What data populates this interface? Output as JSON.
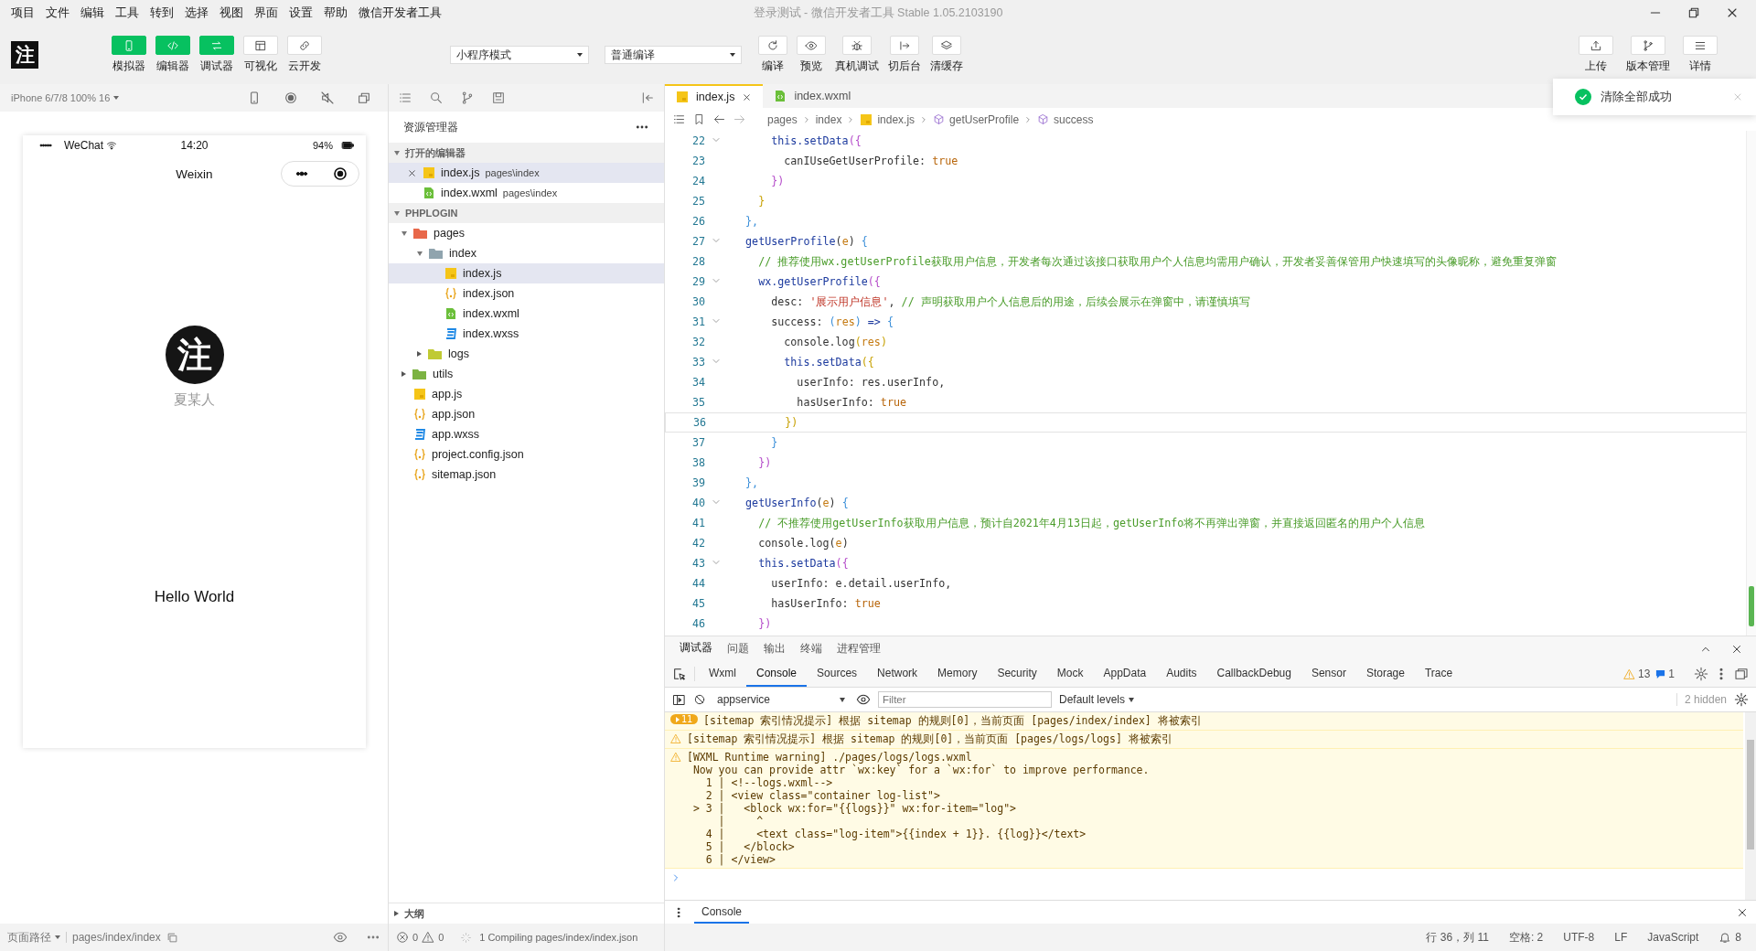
{
  "menu_bar": {
    "items": [
      "项目",
      "文件",
      "编辑",
      "工具",
      "转到",
      "选择",
      "视图",
      "界面",
      "设置",
      "帮助",
      "微信开发者工具"
    ],
    "title": "登录测试 - 微信开发者工具 Stable 1.05.2103190"
  },
  "toolbar": {
    "logo_text": "注",
    "view_buttons": [
      {
        "label": "模拟器",
        "active": true
      },
      {
        "label": "编辑器",
        "active": true
      },
      {
        "label": "调试器",
        "active": true
      },
      {
        "label": "可视化",
        "active": false
      },
      {
        "label": "云开发",
        "active": false
      }
    ],
    "mode_select": "小程序模式",
    "compile_select": "普通编译",
    "action_buttons": [
      "编译",
      "预览",
      "真机调试",
      "切后台",
      "清缓存"
    ],
    "right_buttons": [
      "上传",
      "版本管理",
      "详情"
    ]
  },
  "toast": {
    "text": "清除全部成功"
  },
  "simulator": {
    "device": "iPhone 6/7/8 100% 16",
    "carrier": "WeChat",
    "time": "14:20",
    "battery": "94%",
    "nav_title": "Weixin",
    "avatar_text": "注",
    "user_name": "夏某人",
    "greeting": "Hello World",
    "page_path_label": "页面路径",
    "page_path": "pages/index/index"
  },
  "explorer": {
    "title": "资源管理器",
    "open_editors_title": "打开的编辑器",
    "open_editors": [
      {
        "name": "index.js",
        "path": "pages\\index",
        "kind": "js",
        "selected": true
      },
      {
        "name": "index.wxml",
        "path": "pages\\index",
        "kind": "wxml",
        "selected": false
      }
    ],
    "project_title": "PHPLOGIN",
    "tree": [
      {
        "name": "pages",
        "kind": "folder",
        "color": "#e8684a",
        "expanded": true,
        "selected": false,
        "children": [
          {
            "name": "index",
            "kind": "folder",
            "color": "#90a4ae",
            "expanded": true,
            "selected": false,
            "children": [
              {
                "name": "index.js",
                "kind": "js",
                "selected": true
              },
              {
                "name": "index.json",
                "kind": "json",
                "selected": false
              },
              {
                "name": "index.wxml",
                "kind": "wxml",
                "selected": false
              },
              {
                "name": "index.wxss",
                "kind": "wxss",
                "selected": false
              }
            ]
          },
          {
            "name": "logs",
            "kind": "folder",
            "color": "#c0ca33",
            "expanded": false,
            "selected": false
          }
        ]
      },
      {
        "name": "utils",
        "kind": "folder",
        "color": "#7cb342",
        "expanded": false,
        "selected": false
      },
      {
        "name": "app.js",
        "kind": "js",
        "selected": false
      },
      {
        "name": "app.json",
        "kind": "json",
        "selected": false
      },
      {
        "name": "app.wxss",
        "kind": "wxss",
        "selected": false
      },
      {
        "name": "project.config.json",
        "kind": "json",
        "selected": false
      },
      {
        "name": "sitemap.json",
        "kind": "json",
        "selected": false
      }
    ],
    "outline_title": "大纲",
    "errors": "0",
    "warnings": "0",
    "compile_status": "1 Compiling pages/index/index.json"
  },
  "editor": {
    "tabs": [
      {
        "label": "index.js",
        "kind": "js",
        "selected": true
      },
      {
        "label": "index.wxml",
        "kind": "wxml",
        "selected": false
      }
    ],
    "breadcrumb": [
      {
        "text": "pages",
        "kind": "folder"
      },
      {
        "text": "index",
        "kind": "folder"
      },
      {
        "text": "index.js",
        "kind": "js"
      },
      {
        "text": "getUserProfile",
        "kind": "method"
      },
      {
        "text": "success",
        "kind": "method"
      }
    ],
    "lines": [
      {
        "number": "22",
        "foldable": true,
        "current": false,
        "tokens": [
          {
            "text": "      this.setData",
            "kind": "keyword"
          },
          {
            "text": "({",
            "kind": "b2"
          }
        ]
      },
      {
        "number": "23",
        "foldable": false,
        "current": false,
        "tokens": [
          {
            "text": "        canIUseGetUserProfile: ",
            "kind": "plain"
          },
          {
            "text": "true",
            "kind": "bool"
          }
        ]
      },
      {
        "number": "24",
        "foldable": false,
        "current": false,
        "tokens": [
          {
            "text": "      })",
            "kind": "b2"
          }
        ]
      },
      {
        "number": "25",
        "foldable": false,
        "current": false,
        "tokens": [
          {
            "text": "    }",
            "kind": "b1"
          }
        ]
      },
      {
        "number": "26",
        "foldable": false,
        "current": false,
        "tokens": [
          {
            "text": "  },",
            "kind": "b3"
          }
        ]
      },
      {
        "number": "27",
        "foldable": true,
        "current": false,
        "tokens": [
          {
            "text": "  getUserProfile",
            "kind": "keyword"
          },
          {
            "text": "(",
            "kind": "plain"
          },
          {
            "text": "e",
            "kind": "param"
          },
          {
            "text": ") ",
            "kind": "plain"
          },
          {
            "text": "{",
            "kind": "b3"
          }
        ]
      },
      {
        "number": "28",
        "foldable": false,
        "current": false,
        "tokens": [
          {
            "text": "    // 推荐使用wx.getUserProfile获取用户信息，开发者每次通过该接口获取用户个人信息均需用户确认，开发者妥善保管用户快速填写的头像昵称，避免重复弹窗",
            "kind": "comment"
          }
        ]
      },
      {
        "number": "29",
        "foldable": true,
        "current": false,
        "tokens": [
          {
            "text": "    wx.getUserProfile",
            "kind": "keyword"
          },
          {
            "text": "({",
            "kind": "b2"
          }
        ]
      },
      {
        "number": "30",
        "foldable": false,
        "current": false,
        "tokens": [
          {
            "text": "      desc: ",
            "kind": "plain"
          },
          {
            "text": "'展示用户信息'",
            "kind": "string"
          },
          {
            "text": ", ",
            "kind": "plain"
          },
          {
            "text": "// 声明获取用户个人信息后的用途，后续会展示在弹窗中，请谨慎填写",
            "kind": "comment"
          }
        ]
      },
      {
        "number": "31",
        "foldable": true,
        "current": false,
        "tokens": [
          {
            "text": "      success: ",
            "kind": "plain"
          },
          {
            "text": "(",
            "kind": "b3"
          },
          {
            "text": "res",
            "kind": "param"
          },
          {
            "text": ")",
            "kind": "b3"
          },
          {
            "text": " => ",
            "kind": "keyword"
          },
          {
            "text": "{",
            "kind": "b3"
          }
        ]
      },
      {
        "number": "32",
        "foldable": false,
        "current": false,
        "tokens": [
          {
            "text": "        console.log",
            "kind": "plain"
          },
          {
            "text": "(",
            "kind": "b1"
          },
          {
            "text": "res",
            "kind": "param"
          },
          {
            "text": ")",
            "kind": "b1"
          }
        ]
      },
      {
        "number": "33",
        "foldable": true,
        "current": false,
        "tokens": [
          {
            "text": "        this.setData",
            "kind": "keyword"
          },
          {
            "text": "({",
            "kind": "b1"
          }
        ]
      },
      {
        "number": "34",
        "foldable": false,
        "current": false,
        "tokens": [
          {
            "text": "          userInfo: res.userInfo,",
            "kind": "plain"
          }
        ]
      },
      {
        "number": "35",
        "foldable": false,
        "current": false,
        "tokens": [
          {
            "text": "          hasUserInfo: ",
            "kind": "plain"
          },
          {
            "text": "true",
            "kind": "bool"
          }
        ]
      },
      {
        "number": "36",
        "foldable": false,
        "current": true,
        "tokens": [
          {
            "text": "        })",
            "kind": "b1"
          }
        ]
      },
      {
        "number": "37",
        "foldable": false,
        "current": false,
        "tokens": [
          {
            "text": "      }",
            "kind": "b3"
          }
        ]
      },
      {
        "number": "38",
        "foldable": false,
        "current": false,
        "tokens": [
          {
            "text": "    })",
            "kind": "b2"
          }
        ]
      },
      {
        "number": "39",
        "foldable": false,
        "current": false,
        "tokens": [
          {
            "text": "  },",
            "kind": "b3"
          }
        ]
      },
      {
        "number": "40",
        "foldable": true,
        "current": false,
        "tokens": [
          {
            "text": "  getUserInfo",
            "kind": "keyword"
          },
          {
            "text": "(",
            "kind": "plain"
          },
          {
            "text": "e",
            "kind": "param"
          },
          {
            "text": ") ",
            "kind": "plain"
          },
          {
            "text": "{",
            "kind": "b3"
          }
        ]
      },
      {
        "number": "41",
        "foldable": false,
        "current": false,
        "tokens": [
          {
            "text": "    // 不推荐使用getUserInfo获取用户信息，预计自2021年4月13日起，getUserInfo将不再弹出弹窗，并直接返回匿名的用户个人信息",
            "kind": "comment"
          }
        ]
      },
      {
        "number": "42",
        "foldable": false,
        "current": false,
        "tokens": [
          {
            "text": "    console.log",
            "kind": "plain"
          },
          {
            "text": "(",
            "kind": "plain"
          },
          {
            "text": "e",
            "kind": "param"
          },
          {
            "text": ")",
            "kind": "plain"
          }
        ]
      },
      {
        "number": "43",
        "foldable": true,
        "current": false,
        "tokens": [
          {
            "text": "    this.setData",
            "kind": "keyword"
          },
          {
            "text": "({",
            "kind": "b2"
          }
        ]
      },
      {
        "number": "44",
        "foldable": false,
        "current": false,
        "tokens": [
          {
            "text": "      userInfo: e.detail.userInfo,",
            "kind": "plain"
          }
        ]
      },
      {
        "number": "45",
        "foldable": false,
        "current": false,
        "tokens": [
          {
            "text": "      hasUserInfo: ",
            "kind": "plain"
          },
          {
            "text": "true",
            "kind": "bool"
          }
        ]
      },
      {
        "number": "46",
        "foldable": false,
        "current": false,
        "tokens": [
          {
            "text": "    })",
            "kind": "b2"
          }
        ]
      }
    ]
  },
  "debugger": {
    "panel_tabs": [
      {
        "label": "调试器",
        "selected": true
      },
      {
        "label": "问题",
        "selected": false
      },
      {
        "label": "输出",
        "selected": false
      },
      {
        "label": "终端",
        "selected": false
      },
      {
        "label": "进程管理",
        "selected": false
      }
    ],
    "devtools_tabs": [
      {
        "label": "Wxml",
        "selected": false
      },
      {
        "label": "Console",
        "selected": true
      },
      {
        "label": "Sources",
        "selected": false
      },
      {
        "label": "Network",
        "selected": false
      },
      {
        "label": "Memory",
        "selected": false
      },
      {
        "label": "Security",
        "selected": false
      },
      {
        "label": "Mock",
        "selected": false
      },
      {
        "label": "AppData",
        "selected": false
      },
      {
        "label": "Audits",
        "selected": false
      },
      {
        "label": "CallbackDebug",
        "selected": false
      },
      {
        "label": "Sensor",
        "selected": false
      },
      {
        "label": "Storage",
        "selected": false
      },
      {
        "label": "Trace",
        "selected": false
      }
    ],
    "warning_count": "13",
    "info_count": "1",
    "context": "appservice",
    "filter": {
      "placeholder": "Filter"
    },
    "levels": "Default levels",
    "hidden_count": "2 hidden",
    "messages": [
      {
        "kind": "warning",
        "count": "11",
        "text": "[sitemap 索引情况提示] 根据 sitemap 的规则[0]，当前页面 [pages/index/index] 将被索引"
      },
      {
        "kind": "warning",
        "text": "[sitemap 索引情况提示] 根据 sitemap 的规则[0]，当前页面 [pages/logs/logs] 将被索引"
      },
      {
        "kind": "warning",
        "text": "[WXML Runtime warning] ./pages/logs/logs.wxml",
        "details": [
          " Now you can provide attr `wx:key` for a `wx:for` to improve performance.",
          "   1 | <!--logs.wxml-->",
          "   2 | <view class=\"container log-list\">",
          " > 3 |   <block wx:for=\"{{logs}}\" wx:for-item=\"log\">",
          "     |     ^",
          "   4 |     <text class=\"log-item\">{{index + 1}}. {{log}}</text>",
          "   5 |   </block>",
          "   6 | </view>"
        ]
      }
    ],
    "drawer_tab": "Console"
  },
  "status_bar": {
    "position": "行 36，列 11",
    "indent": "空格: 2",
    "encoding": "UTF-8",
    "eol": "LF",
    "language": "JavaScript",
    "notifications": "8"
  }
}
